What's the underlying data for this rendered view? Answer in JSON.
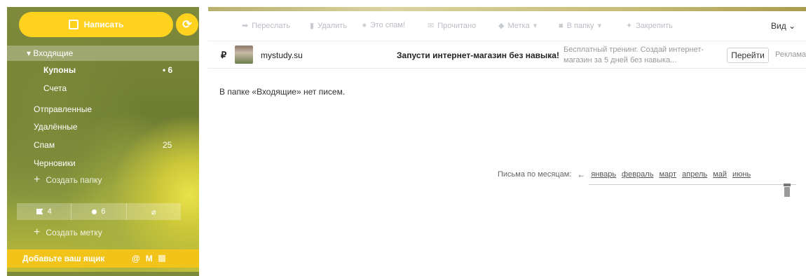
{
  "sidebar": {
    "compose_label": "Написать",
    "folders": [
      {
        "label": "▾ Входящие",
        "count": ""
      },
      {
        "label": "Купоны",
        "count": "• 6"
      },
      {
        "label": "Счета",
        "count": ""
      },
      {
        "label": "Отправленные",
        "count": ""
      },
      {
        "label": "Удалённые",
        "count": ""
      },
      {
        "label": "Спам",
        "count": "25"
      },
      {
        "label": "Черновики",
        "count": ""
      }
    ],
    "create_folder": "Создать папку",
    "labels_bar": {
      "flagged_count": "4",
      "unread_count": "6"
    },
    "create_label": "Создать метку",
    "add_mailbox": "Добавьте ваш ящик"
  },
  "toolbar": {
    "forward": "Переслать",
    "delete": "Удалить",
    "spam": "Это спам!",
    "read": "Прочитано",
    "label": "Метка",
    "to_folder": "В папку",
    "pin": "Закрепить",
    "view": "Вид"
  },
  "ad": {
    "currency_icon": "₽",
    "sender": "mystudy.su",
    "subject": "Запусти интернет-магазин без навыка!",
    "snippet": "Бесплатный тренинг. Создай интернет-магазин за 5 дней без навыка...",
    "go_button": "Перейти",
    "ad_label": "Реклама"
  },
  "empty_message": "В папке «Входящие» нет писем.",
  "months": {
    "label": "Письма по месяцам:",
    "items": [
      "январь",
      "февраль",
      "март",
      "апрель",
      "май",
      "июнь"
    ]
  },
  "colors": {
    "accent": "#ffd21f",
    "mailbox_bar": "#f2c318"
  }
}
